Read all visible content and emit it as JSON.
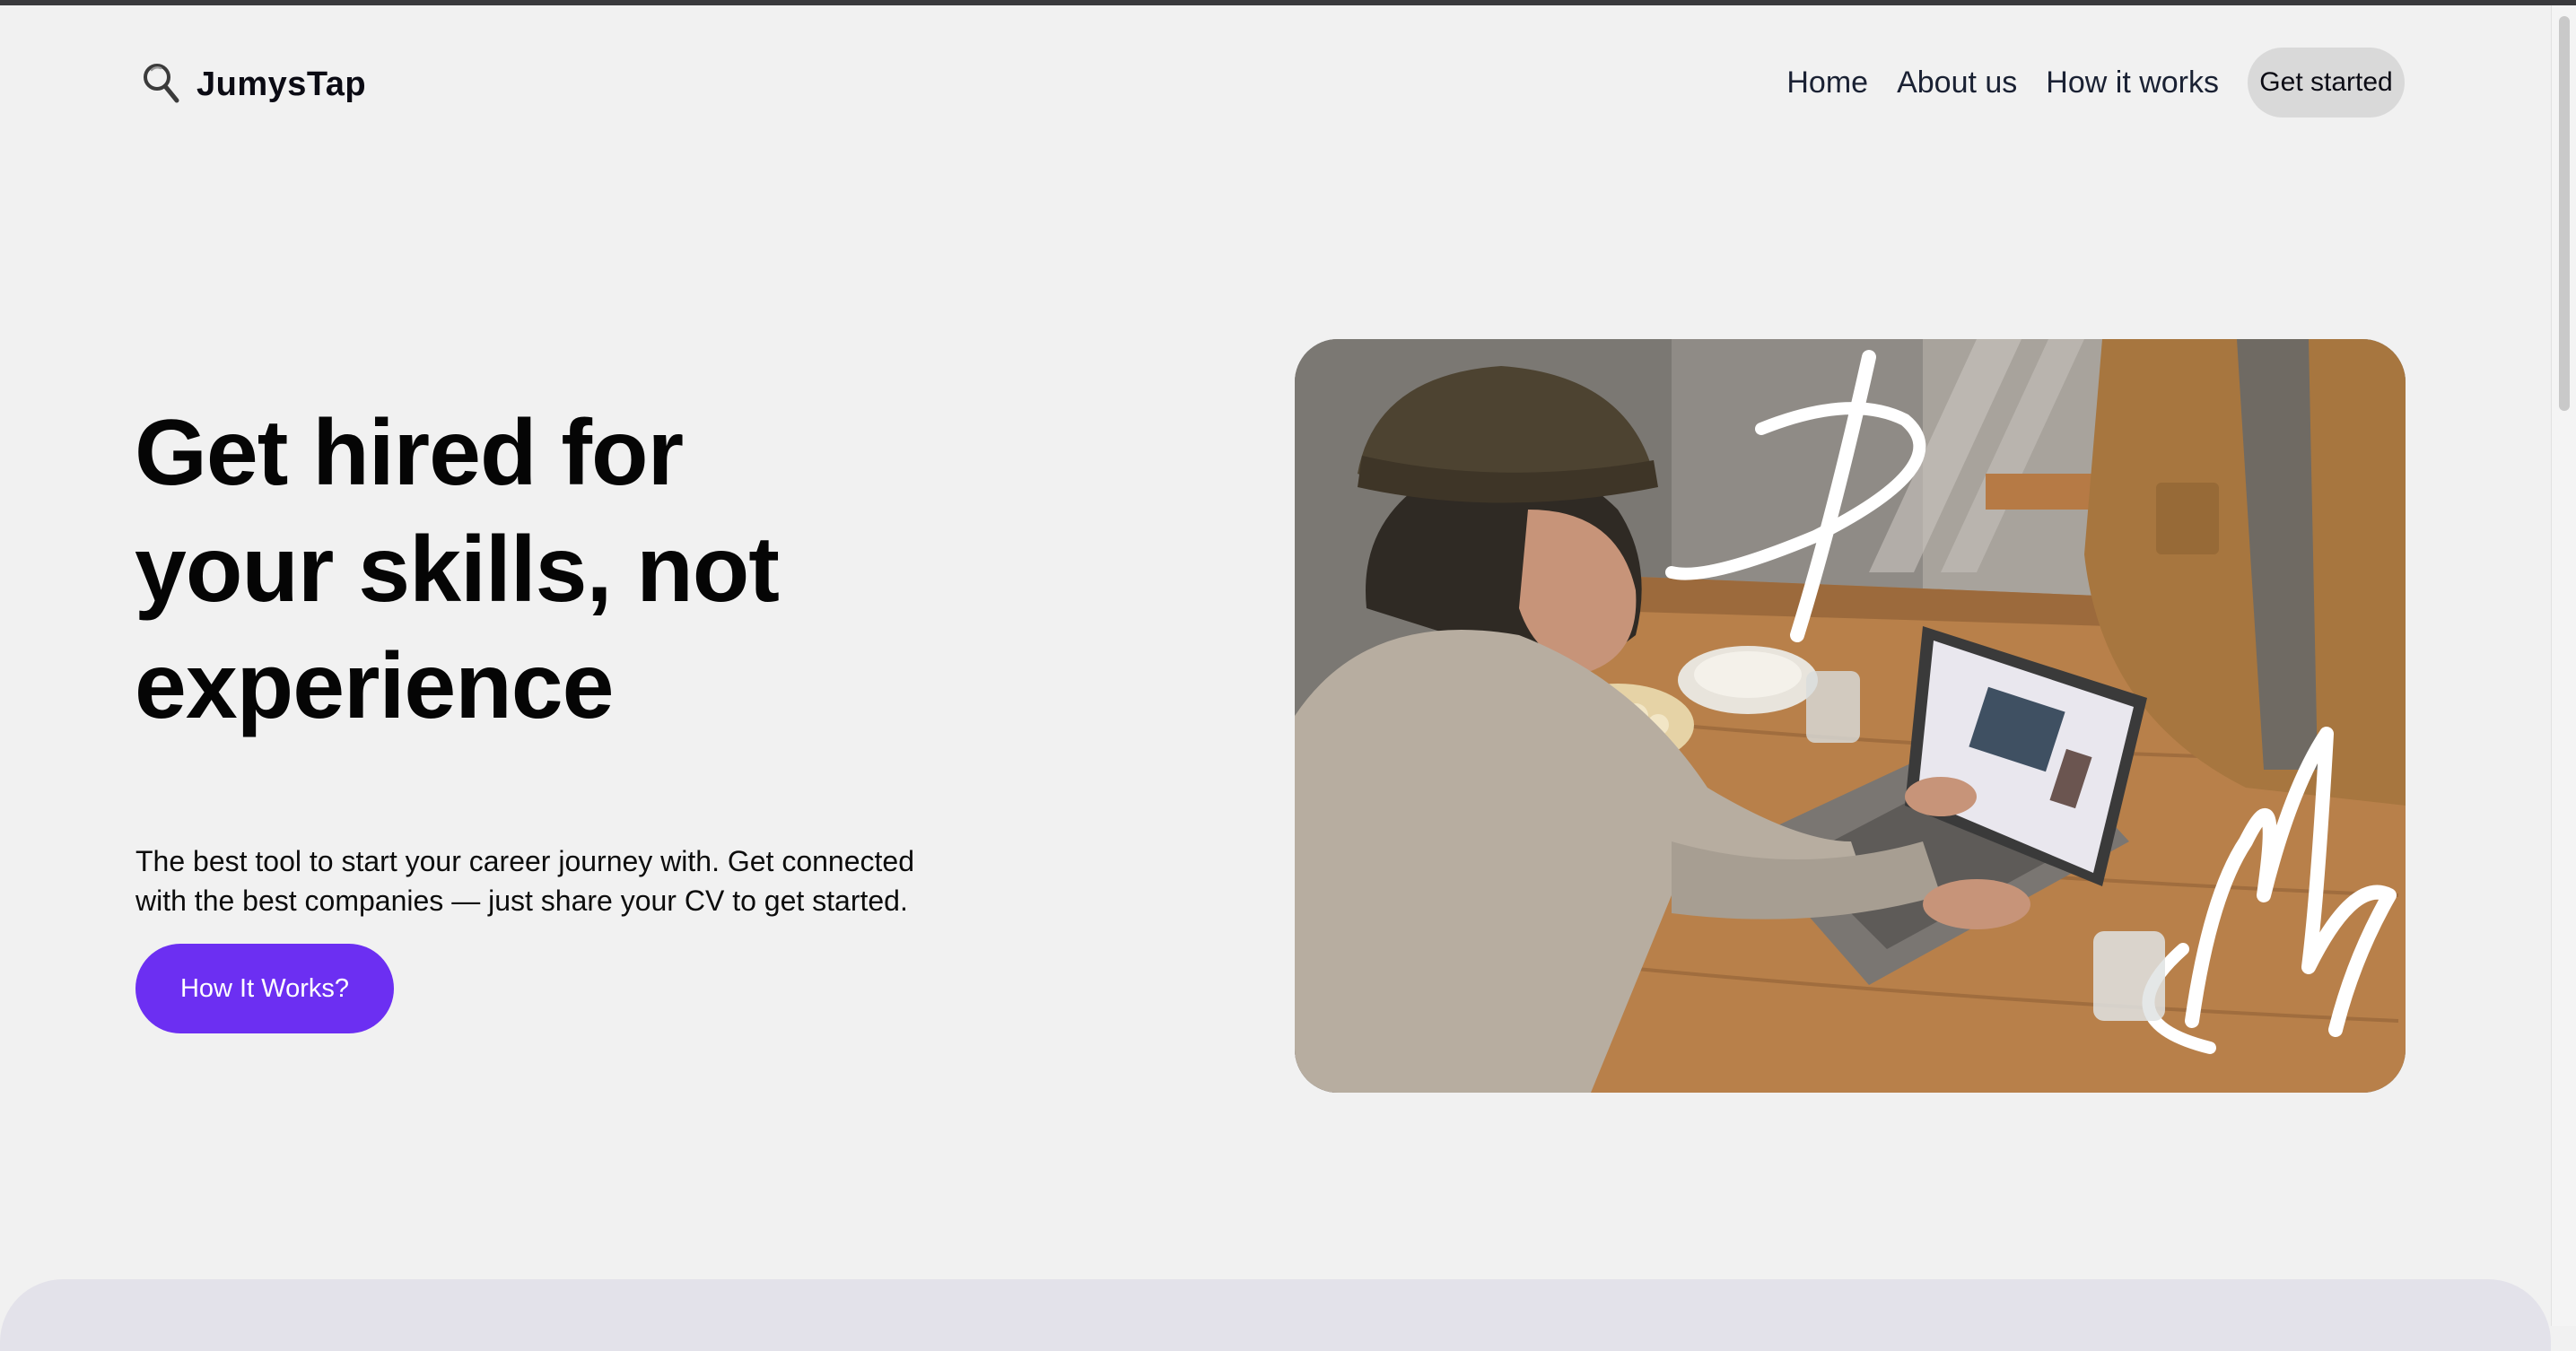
{
  "brand": {
    "name": "JumysTap",
    "icon": "magnifier-icon"
  },
  "nav": {
    "items": [
      {
        "label": "Home"
      },
      {
        "label": "About us"
      },
      {
        "label": "How it works"
      }
    ],
    "cta_label": "Get started"
  },
  "hero": {
    "title_lines": [
      "Get hired for",
      "your skills, not",
      "experience"
    ],
    "subtitle_line1": "The best tool to start your career journey with. Get connected",
    "subtitle_line2": "with the best companies — just share your CV to get started.",
    "button_label": "How It Works?",
    "image": "photo of a woman in a beanie using a laptop at a wooden table"
  },
  "colors": {
    "background": "#f1f1f1",
    "accent": "#6c2ff2",
    "nav_cta_bg": "#d9d9d9",
    "next_section_bg": "#e3e2ea"
  }
}
